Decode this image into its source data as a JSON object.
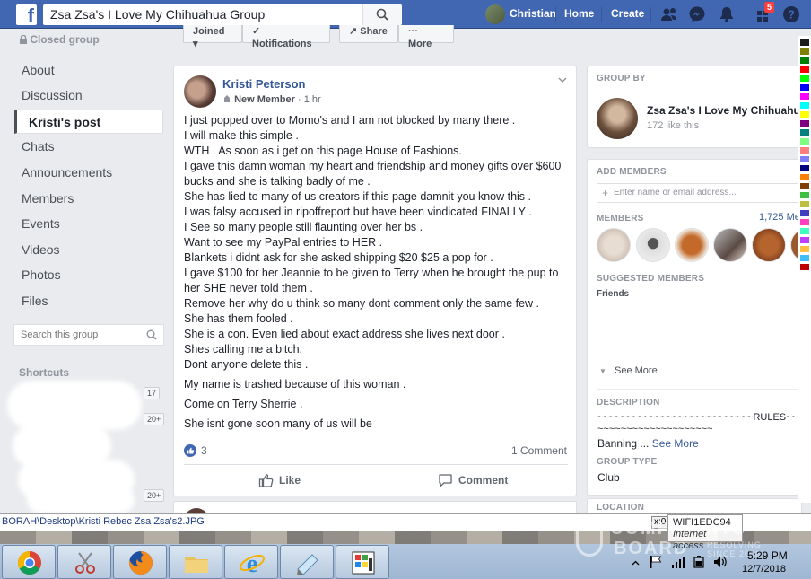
{
  "topbar": {
    "search_value": "Zsa Zsa's I Love My Chihuahua Group",
    "user_name": "Christian",
    "home": "Home",
    "create": "Create",
    "notif_count": "5"
  },
  "left_nav": {
    "closed_group": "Closed group",
    "items": [
      "About",
      "Discussion",
      "Kristi's post",
      "Chats",
      "Announcements",
      "Members",
      "Events",
      "Videos",
      "Photos",
      "Files"
    ],
    "search_placeholder": "Search this group",
    "shortcuts": "Shortcuts",
    "shortcut_badges": [
      "17",
      "20+",
      "20+"
    ]
  },
  "group_actions": [
    "Joined",
    "Notifications",
    "Share",
    "More"
  ],
  "post": {
    "author": "Kristi Peterson",
    "badge": "New Member",
    "time": "1 hr",
    "lines": [
      "I just popped over to Momo's and I am not blocked by many there .",
      "I will make this simple .",
      "WTH . As soon as i get on this page House of Fashions.",
      "I gave this damn woman my heart and friendship and money gifts over $600",
      "bucks and she is talking badly of me .",
      "She has lied to many of us creators if this page damnit you know this .",
      "I was falsy accused in ripoffreport but have been vindicated FINALLY .",
      "I See so many people still flaunting over her bs .",
      "Want to see my PayPal entries to HER .",
      "Blankets i didnt ask for she asked shipping $20 $25 a pop for .",
      "I gave $100 for her Jeannie to be given to Terry when he brought the pup to",
      "her SHE never told them .",
      "Remove her why do u think so many dont comment only the same few .",
      "She has them fooled .",
      "She is a con. Even lied about exact address she lives next door .",
      "Shes calling me a bitch.",
      "Dont anyone delete this ."
    ],
    "para2": "My name is trashed because of this woman .",
    "para3": "Come on Terry Sherrie .",
    "para4": "She isnt gone soon many of us will be",
    "reaction_count": "3",
    "comment_count": "1 Comment",
    "like_label": "Like",
    "comment_label": "Comment"
  },
  "right": {
    "group_by_label": "GROUP BY",
    "group_name": "Zsa Zsa's I Love My Chihuahua",
    "group_likes": "172 like this",
    "add_members_label": "ADD MEMBERS",
    "add_member_placeholder": "Enter name or email address...",
    "members_label": "MEMBERS",
    "members_count": "1,725 Me",
    "suggested_label": "SUGGESTED MEMBERS",
    "friends_label": "Friends",
    "see_more": "See More",
    "description_label": "DESCRIPTION",
    "desc_rules": "~~~~~~~~~~~~~~~~~~~~~~~~~~~RULES~~",
    "desc_tildes": "~~~~~~~~~~~~~~~~~~~~",
    "desc_banning": "Banning ...",
    "desc_see_more": "See More",
    "group_type_label": "GROUP TYPE",
    "group_type_value": "Club",
    "location_label": "LOCATION"
  },
  "statusbar": {
    "path": "BORAH\\Desktop\\Kristi Rebec Zsa Zsa's2.JPG",
    "x_label": "x:0"
  },
  "popup": {
    "network": "WIFI1EDC94",
    "access": "Internet access"
  },
  "watermark": {
    "line1": "COMPLAINTS",
    "line2": "BOARD",
    "line3a": "RESOLVING",
    "line3b": "SINCE 2006"
  },
  "clock": {
    "time": "5:29 PM",
    "date": "12/7/2018"
  },
  "colors": {
    "fb_blue": "#4267b2",
    "link_blue": "#365899"
  }
}
